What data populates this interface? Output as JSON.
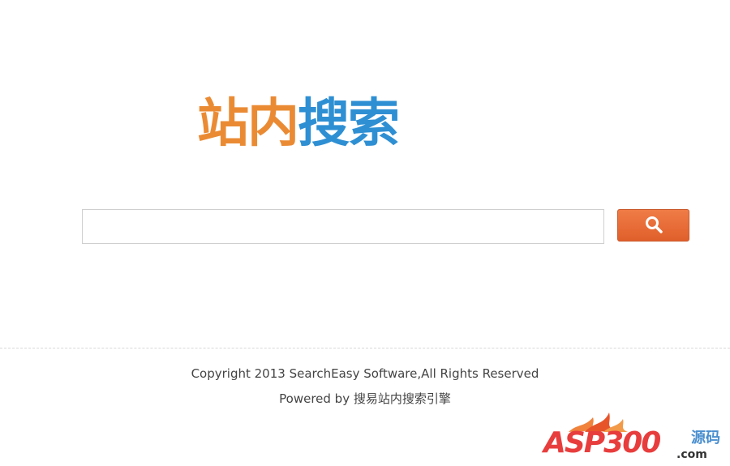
{
  "logo": {
    "text_orange": "站内",
    "text_blue": "搜索"
  },
  "search": {
    "value": "",
    "placeholder": "",
    "button_icon": "search-icon"
  },
  "footer": {
    "copyright": "Copyright 2013 SearchEasy Software,All Rights Reserved",
    "powered": "Powered by 搜易站内搜索引擎"
  },
  "watermark": {
    "brand": "ASP300",
    "cn": "源码",
    "domain": ".com"
  },
  "colors": {
    "logo_orange": "#ea8b34",
    "logo_blue": "#2e8fd3",
    "button": "#e8683a",
    "watermark_red": "#e83d3d"
  }
}
